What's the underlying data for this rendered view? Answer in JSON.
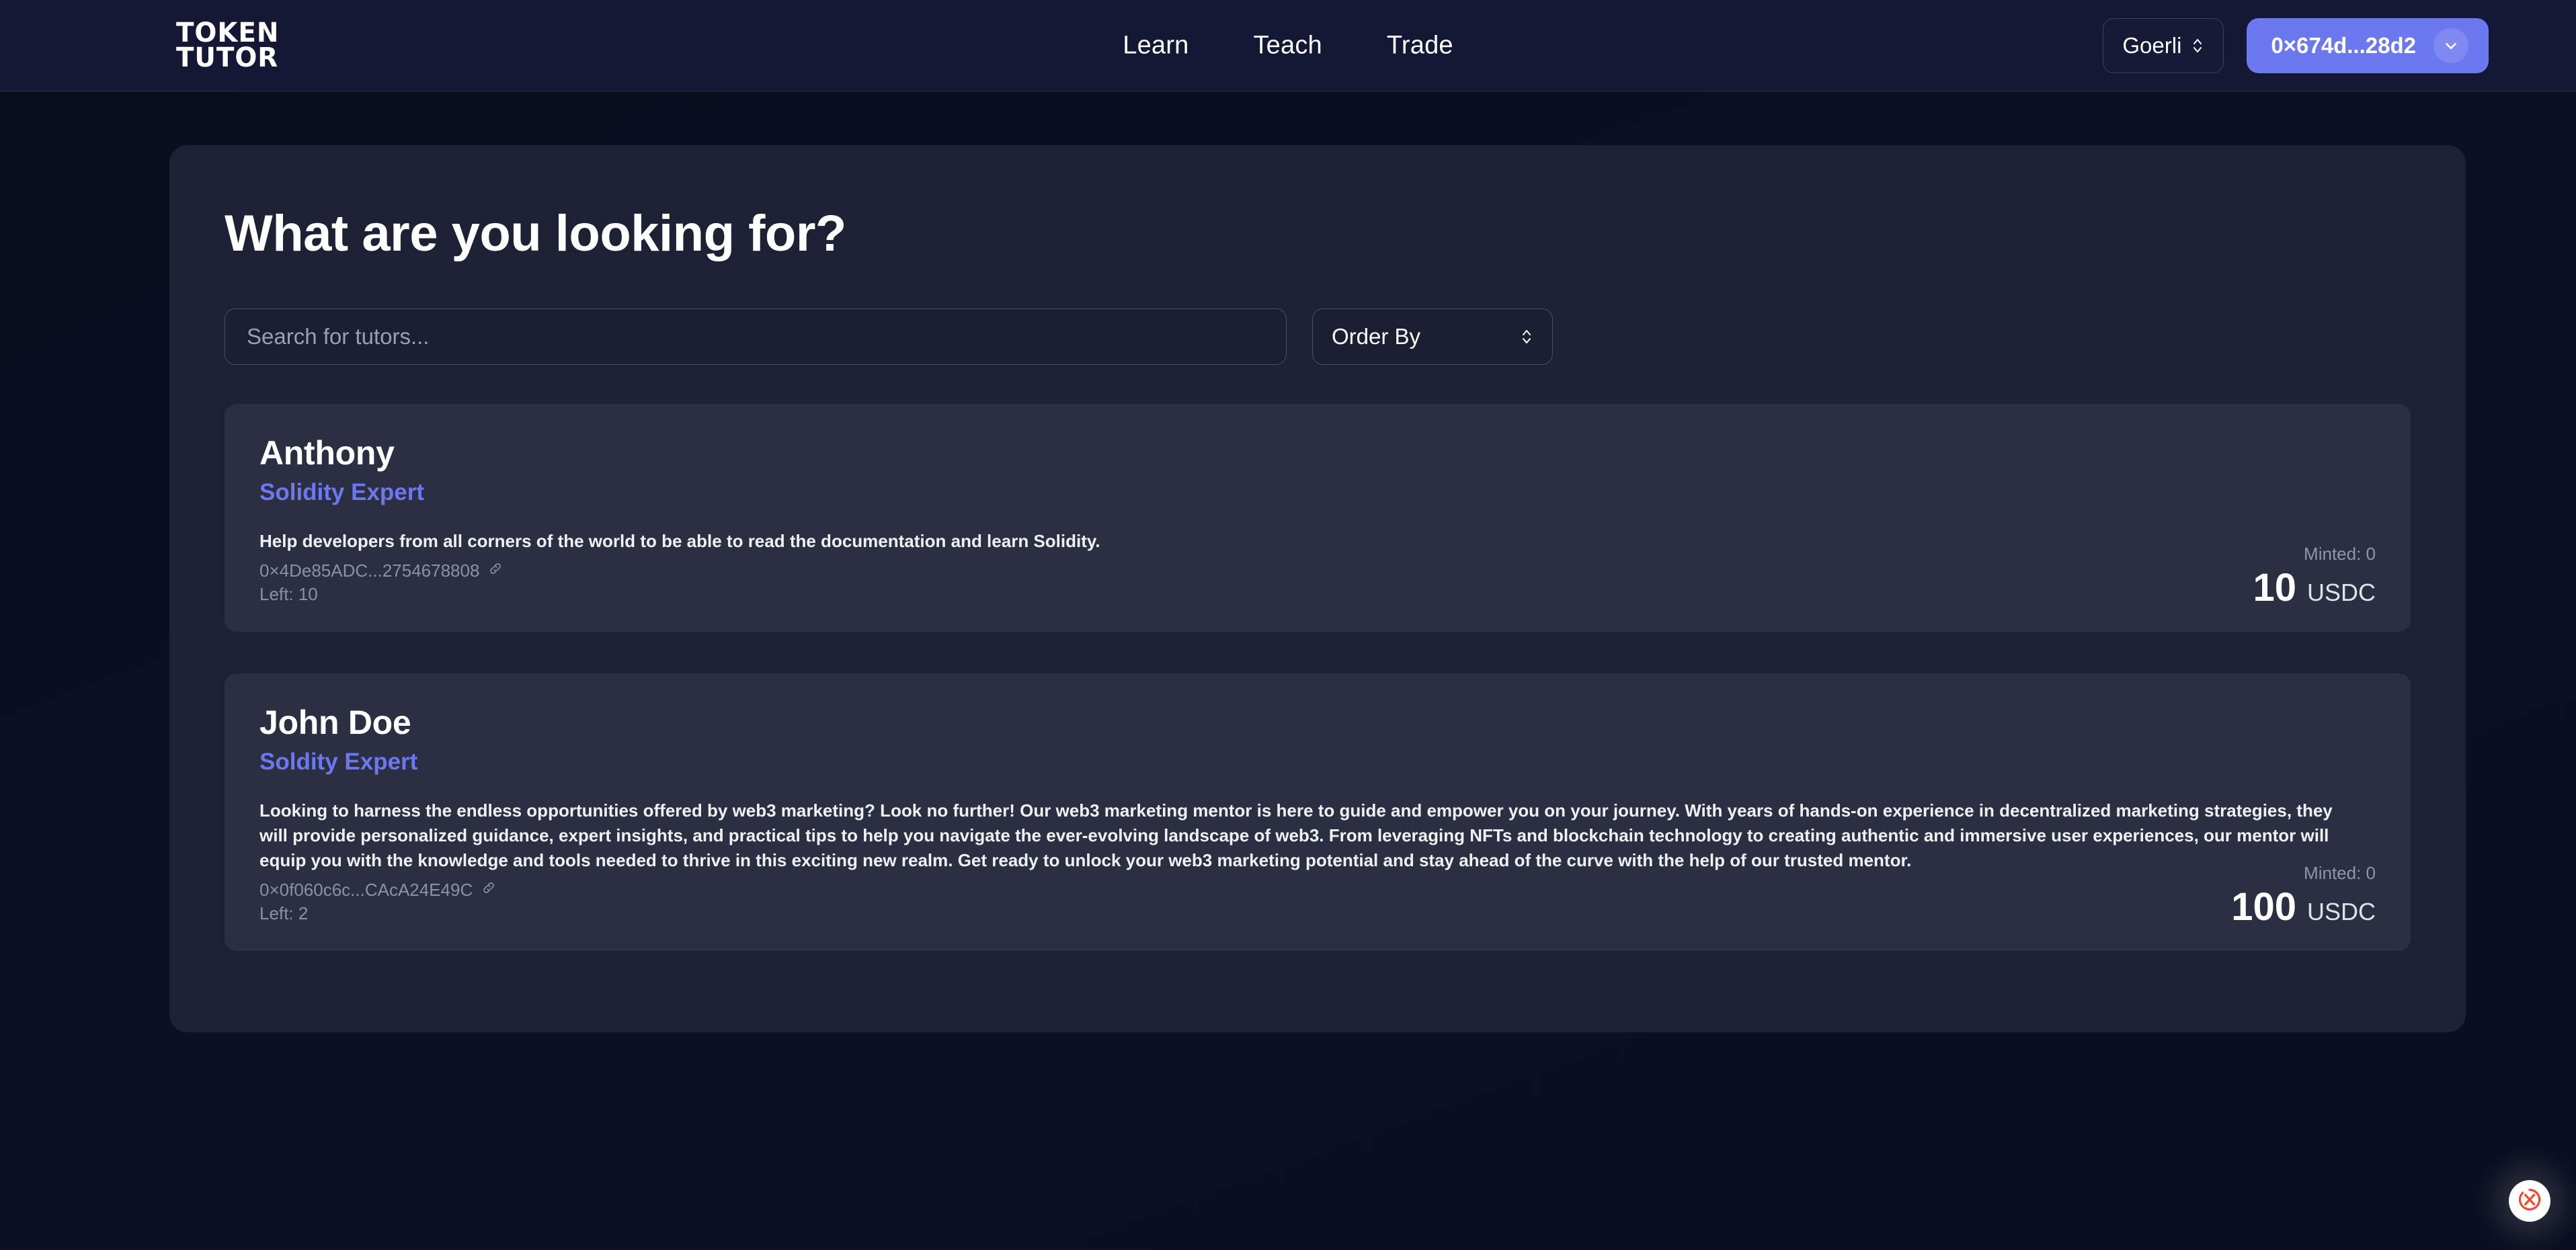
{
  "header": {
    "logo_line1": "TOKEN",
    "logo_line2": "TUTOR",
    "nav": [
      {
        "label": "Learn"
      },
      {
        "label": "Teach"
      },
      {
        "label": "Trade"
      }
    ],
    "network": {
      "label": "Goerli",
      "icon": "up-down-chevron-icon"
    },
    "wallet": {
      "address": "0×674d...28d2",
      "icon": "chevron-down-icon"
    },
    "accent_color": "#6b78ef",
    "background_color": "#141834"
  },
  "main": {
    "title": "What are you looking for?",
    "search": {
      "placeholder": "Search for tutors...",
      "value": ""
    },
    "order_by": {
      "label": "Order By",
      "icon": "up-down-chevron-icon"
    },
    "panel_color": "#1d2133",
    "card_color": "#2b2f41",
    "tutors": [
      {
        "name": "Anthony",
        "role": "Solidity Expert",
        "description": "Help developers from all corners of the world to be able to read the documentation and learn Solidity.",
        "address": "0×4De85ADC...2754678808",
        "link_icon": "link-icon",
        "left": "Left: 10",
        "minted": "Minted: 0",
        "price": "10",
        "currency": "USDC"
      },
      {
        "name": "John Doe",
        "role": "Soldity Expert",
        "description": "Looking to harness the endless opportunities offered by web3 marketing? Look no further! Our web3 marketing mentor is here to guide and empower you on your journey. With years of hands-on experience in decentralized marketing strategies, they will provide personalized guidance, expert insights, and practical tips to help you navigate the ever-evolving landscape of web3. From leveraging NFTs and blockchain technology to creating authentic and immersive user experiences, our mentor will equip you with the knowledge and tools needed to thrive in this exciting new realm. Get ready to unlock your web3 marketing potential and stay ahead of the curve with the help of our trusted mentor.",
        "address": "0×0f060c6c...CAcA24E49C",
        "link_icon": "link-icon",
        "left": "Left: 2",
        "minted": "Minted: 0",
        "price": "100",
        "currency": "USDC"
      }
    ]
  },
  "floating_widget": {
    "icon": "circled-x-logo-icon",
    "color": "#f4492d"
  }
}
